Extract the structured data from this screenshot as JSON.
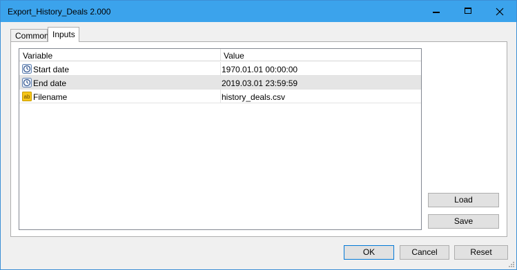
{
  "window": {
    "title": "Export_History_Deals 2.000"
  },
  "tabs": [
    {
      "label": "Common",
      "active": false
    },
    {
      "label": "Inputs",
      "active": true
    }
  ],
  "grid": {
    "headers": {
      "variable": "Variable",
      "value": "Value"
    },
    "rows": [
      {
        "icon": "clock-icon",
        "variable": "Start date",
        "value": "1970.01.01 00:00:00"
      },
      {
        "icon": "clock-icon",
        "variable": "End date",
        "value": "2019.03.01 23:59:59"
      },
      {
        "icon": "string-ab-icon",
        "variable": "Filename",
        "value": "history_deals.csv"
      }
    ]
  },
  "buttons": {
    "load": "Load",
    "save": "Save",
    "ok": "OK",
    "cancel": "Cancel",
    "reset": "Reset"
  },
  "colors": {
    "titlebar": "#3ba3ec",
    "alt_row": "#e5e5e5",
    "ok_border": "#0078d7"
  }
}
